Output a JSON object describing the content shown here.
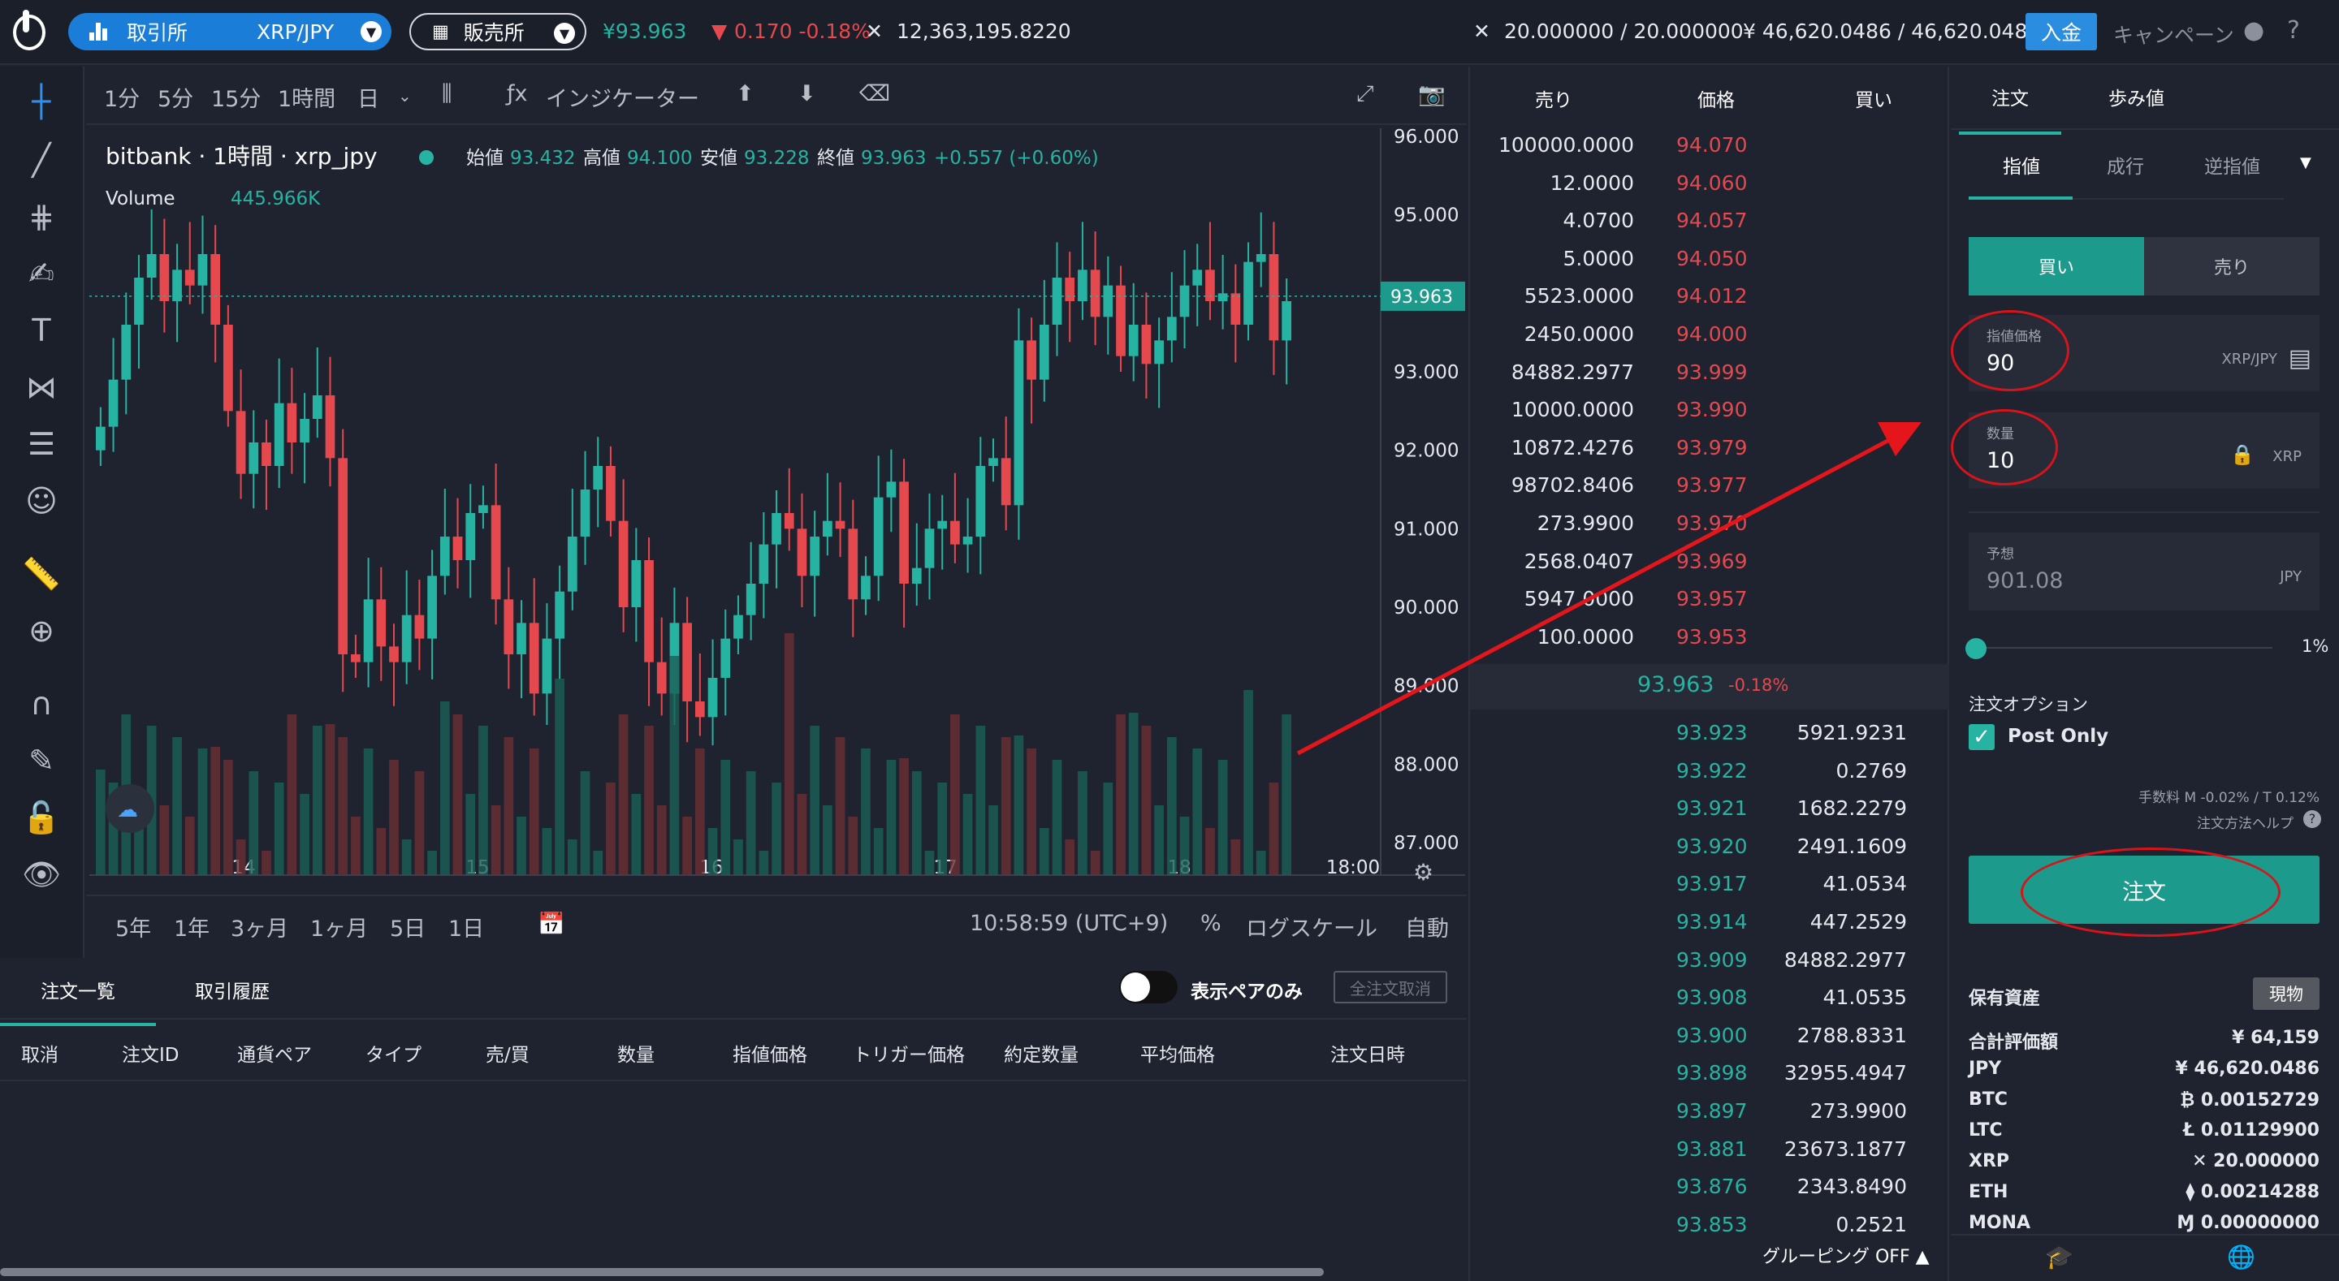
{
  "topbar": {
    "exchange_label": "取引所",
    "pair": "XRP/JPY",
    "store_label": "販売所",
    "price": "¥93.963",
    "change": "0.170 -0.18%",
    "volume": "12,363,195.8220",
    "xrp_balance": "20.000000 / 20.000000",
    "jpy_balance": "¥ 46,620.0486 / 46,620.0486",
    "deposit": "入金",
    "campaign": "キャンペーン",
    "colors": {
      "up": "#27b3a2",
      "down": "#e5484d",
      "accent": "#1a7ed8"
    }
  },
  "chart_toolbar": {
    "intervals": [
      "1分",
      "5分",
      "15分",
      "1時間",
      "日"
    ],
    "active_interval": "1時間",
    "indicators": "インジケーター"
  },
  "chart_legend": {
    "title": "bitbank · 1時間 · xrp_jpy",
    "open_label": "始値",
    "open": "93.432",
    "high_label": "高値",
    "high": "94.100",
    "low_label": "安値",
    "low": "93.228",
    "close_label": "終値",
    "close": "93.963",
    "change": "+0.557 (+0.60%)",
    "volume_label": "Volume",
    "volume": "445.966K",
    "last_price_tag": "93.963"
  },
  "chart_foot": {
    "ranges": [
      "5年",
      "1年",
      "3ヶ月",
      "1ヶ月",
      "5日",
      "1日"
    ],
    "time": "10:58:59 (UTC+9)",
    "percent": "%",
    "log": "ログスケール",
    "auto": "自動"
  },
  "chart_data": {
    "type": "candlestick",
    "ylim": [
      87.0,
      96.0
    ],
    "y_ticks": [
      "96.000",
      "95.000",
      "94.000",
      "93.000",
      "92.000",
      "91.000",
      "90.000",
      "89.000",
      "88.000",
      "87.000"
    ],
    "x_ticks": [
      "14",
      "15",
      "16",
      "17",
      "18",
      "18:00"
    ],
    "closes": [
      92.3,
      92.9,
      93.6,
      94.2,
      94.5,
      93.9,
      94.3,
      94.1,
      94.5,
      93.6,
      92.5,
      91.7,
      92.1,
      91.8,
      92.6,
      92.1,
      92.4,
      92.7,
      91.9,
      89.4,
      89.3,
      90.1,
      89.5,
      89.3,
      89.9,
      89.6,
      90.4,
      90.9,
      90.6,
      91.2,
      91.3,
      90.1,
      89.4,
      89.8,
      88.9,
      89.6,
      90.2,
      90.9,
      91.5,
      91.8,
      91.1,
      90.0,
      90.6,
      89.3,
      88.9,
      89.8,
      88.8,
      88.6,
      89.1,
      89.6,
      89.9,
      90.3,
      90.8,
      91.2,
      91.0,
      90.4,
      90.9,
      91.1,
      91.0,
      90.1,
      90.4,
      91.4,
      91.6,
      90.3,
      90.5,
      91.0,
      91.1,
      90.8,
      90.9,
      91.8,
      91.9,
      91.3,
      93.4,
      92.9,
      93.6,
      94.2,
      93.9,
      94.3,
      93.7,
      94.1,
      93.2,
      93.6,
      93.1,
      93.4,
      93.7,
      94.1,
      94.3,
      93.9,
      94.0,
      93.6,
      94.4,
      94.5,
      93.4,
      93.9
    ],
    "volume_ylim": [
      0,
      2000
    ]
  },
  "order_list": {
    "tabs": [
      "注文一覧",
      "取引履歴"
    ],
    "show_pair_only": "表示ペアのみ",
    "cancel_all": "全注文取消",
    "headers": [
      "取消",
      "注文ID",
      "通貨ペア",
      "タイプ",
      "売/買",
      "数量",
      "指値価格",
      "トリガー価格",
      "約定数量",
      "平均価格",
      "注文日時"
    ]
  },
  "orderbook": {
    "headers": {
      "sell": "売り",
      "price": "価格",
      "buy": "買い"
    },
    "asks": [
      {
        "size": "100000.0000",
        "price": "94.070"
      },
      {
        "size": "12.0000",
        "price": "94.060"
      },
      {
        "size": "4.0700",
        "price": "94.057"
      },
      {
        "size": "5.0000",
        "price": "94.050"
      },
      {
        "size": "5523.0000",
        "price": "94.012"
      },
      {
        "size": "2450.0000",
        "price": "94.000"
      },
      {
        "size": "84882.2977",
        "price": "93.999"
      },
      {
        "size": "10000.0000",
        "price": "93.990"
      },
      {
        "size": "10872.4276",
        "price": "93.979"
      },
      {
        "size": "98702.8406",
        "price": "93.977"
      },
      {
        "size": "273.9900",
        "price": "93.970"
      },
      {
        "size": "2568.0407",
        "price": "93.969"
      },
      {
        "size": "5947.0000",
        "price": "93.957"
      },
      {
        "size": "100.0000",
        "price": "93.953"
      }
    ],
    "mid_price": "93.963",
    "mid_change": "-0.18%",
    "bids": [
      {
        "price": "93.923",
        "size": "5921.9231"
      },
      {
        "price": "93.922",
        "size": "0.2769"
      },
      {
        "price": "93.921",
        "size": "1682.2279"
      },
      {
        "price": "93.920",
        "size": "2491.1609"
      },
      {
        "price": "93.917",
        "size": "41.0534"
      },
      {
        "price": "93.914",
        "size": "447.2529"
      },
      {
        "price": "93.909",
        "size": "84882.2977"
      },
      {
        "price": "93.908",
        "size": "41.0535"
      },
      {
        "price": "93.900",
        "size": "2788.8331"
      },
      {
        "price": "93.898",
        "size": "32955.4947"
      },
      {
        "price": "93.897",
        "size": "273.9900"
      },
      {
        "price": "93.881",
        "size": "23673.1877"
      },
      {
        "price": "93.876",
        "size": "2343.8490"
      },
      {
        "price": "93.853",
        "size": "0.2521"
      }
    ],
    "grouping": "グルーピング OFF"
  },
  "order_panel": {
    "tabs": [
      "注文",
      "歩み値"
    ],
    "sub_tabs": [
      "指値",
      "成行",
      "逆指値"
    ],
    "buy": "買い",
    "sell": "売り",
    "limit_price_label": "指値価格",
    "limit_price": "90",
    "limit_price_unit": "XRP/JPY",
    "qty_label": "数量",
    "qty": "10",
    "qty_unit": "XRP",
    "estimate_label": "予想",
    "estimate": "901.08",
    "estimate_unit": "JPY",
    "slider_label": "1%",
    "slider_value": 0.01,
    "options_label": "注文オプション",
    "post_only": "Post Only",
    "fee": "手数料 M -0.02% / T 0.12%",
    "help": "注文方法ヘルプ",
    "order_button": "注文",
    "assets_label": "保有資産",
    "spot": "現物",
    "assets": [
      {
        "name": "合計評価額",
        "value": "¥ 64,159"
      },
      {
        "name": "JPY",
        "value": "¥ 46,620.0486"
      },
      {
        "name": "BTC",
        "value": "₿ 0.00152729"
      },
      {
        "name": "LTC",
        "value": "Ł 0.01129900"
      },
      {
        "name": "XRP",
        "value": "✕ 20.000000"
      },
      {
        "name": "ETH",
        "value": "⧫ 0.00214288"
      },
      {
        "name": "MONA",
        "value": "Ɱ 0.00000000"
      }
    ]
  }
}
